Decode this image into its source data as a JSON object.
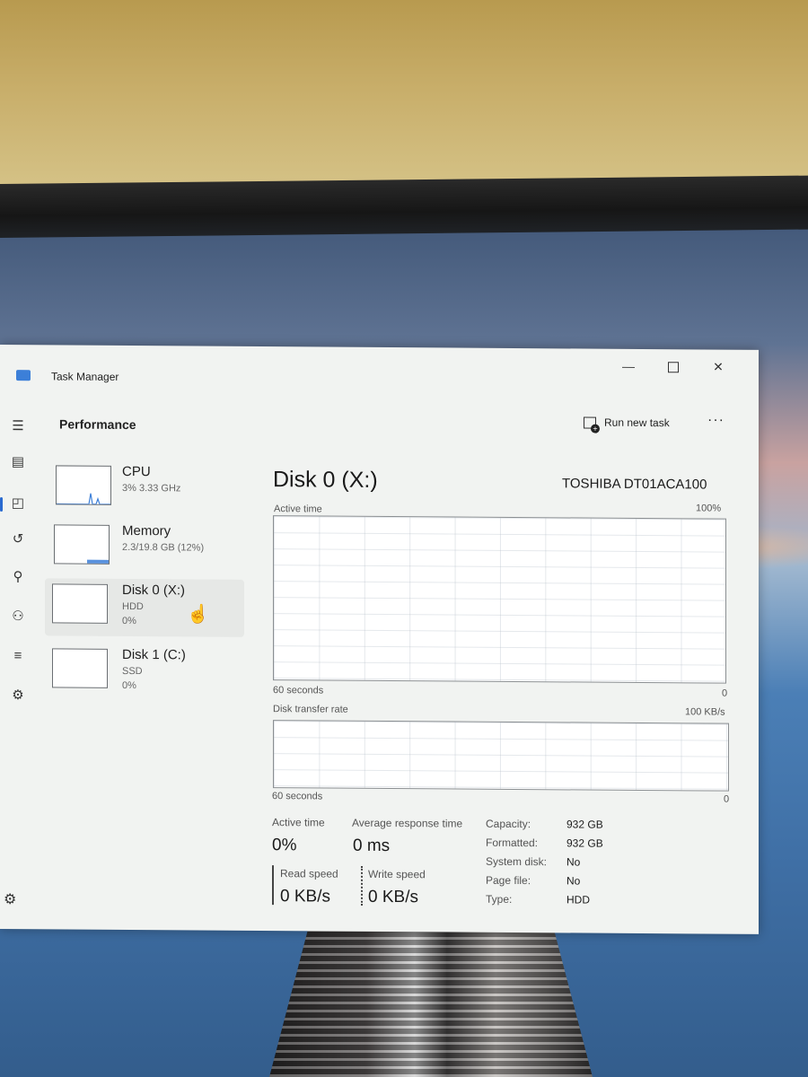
{
  "window": {
    "title": "Task Manager",
    "controls": {
      "minimize": "—",
      "maximize": "",
      "close": "✕"
    }
  },
  "nav_icons": [
    "hamburger-icon",
    "processes-icon",
    "performance-icon",
    "app-history-icon",
    "startup-apps-icon",
    "users-icon",
    "details-icon",
    "services-icon",
    "settings-icon"
  ],
  "header": {
    "page_title": "Performance",
    "run_new_task": "Run new task",
    "more": "···"
  },
  "devices": [
    {
      "name": "CPU",
      "sub": "3% 3.33 GHz",
      "sub2": ""
    },
    {
      "name": "Memory",
      "sub": "2.3/19.8 GB (12%)",
      "sub2": ""
    },
    {
      "name": "Disk 0 (X:)",
      "sub": "HDD",
      "sub2": "0%"
    },
    {
      "name": "Disk 1 (C:)",
      "sub": "SSD",
      "sub2": "0%"
    }
  ],
  "selected_device": "Disk 0 (X:)",
  "disk": {
    "title": "Disk 0 (X:)",
    "model": "TOSHIBA DT01ACA100",
    "active_time_label": "Active time",
    "active_time_max": "100%",
    "active_time_window": "60 seconds",
    "active_time_min": "0",
    "transfer_label": "Disk transfer rate",
    "transfer_max": "100 KB/s",
    "transfer_window": "60 seconds",
    "transfer_min": "0"
  },
  "stats": {
    "active_time_label": "Active time",
    "active_time_value": "0%",
    "avg_response_label": "Average response time",
    "avg_response_value": "0 ms",
    "read_speed_label": "Read speed",
    "read_speed_value": "0 KB/s",
    "write_speed_label": "Write speed",
    "write_speed_value": "0 KB/s"
  },
  "properties": {
    "capacity_label": "Capacity:",
    "capacity_value": "932 GB",
    "formatted_label": "Formatted:",
    "formatted_value": "932 GB",
    "system_disk_label": "System disk:",
    "system_disk_value": "No",
    "page_file_label": "Page file:",
    "page_file_value": "No",
    "type_label": "Type:",
    "type_value": "HDD"
  },
  "colors": {
    "accent": "#2a6ad0",
    "window_bg": "#f1f3f1",
    "cpu_graph": "#3c7fd8",
    "memory_graph": "#3c7fd8"
  }
}
